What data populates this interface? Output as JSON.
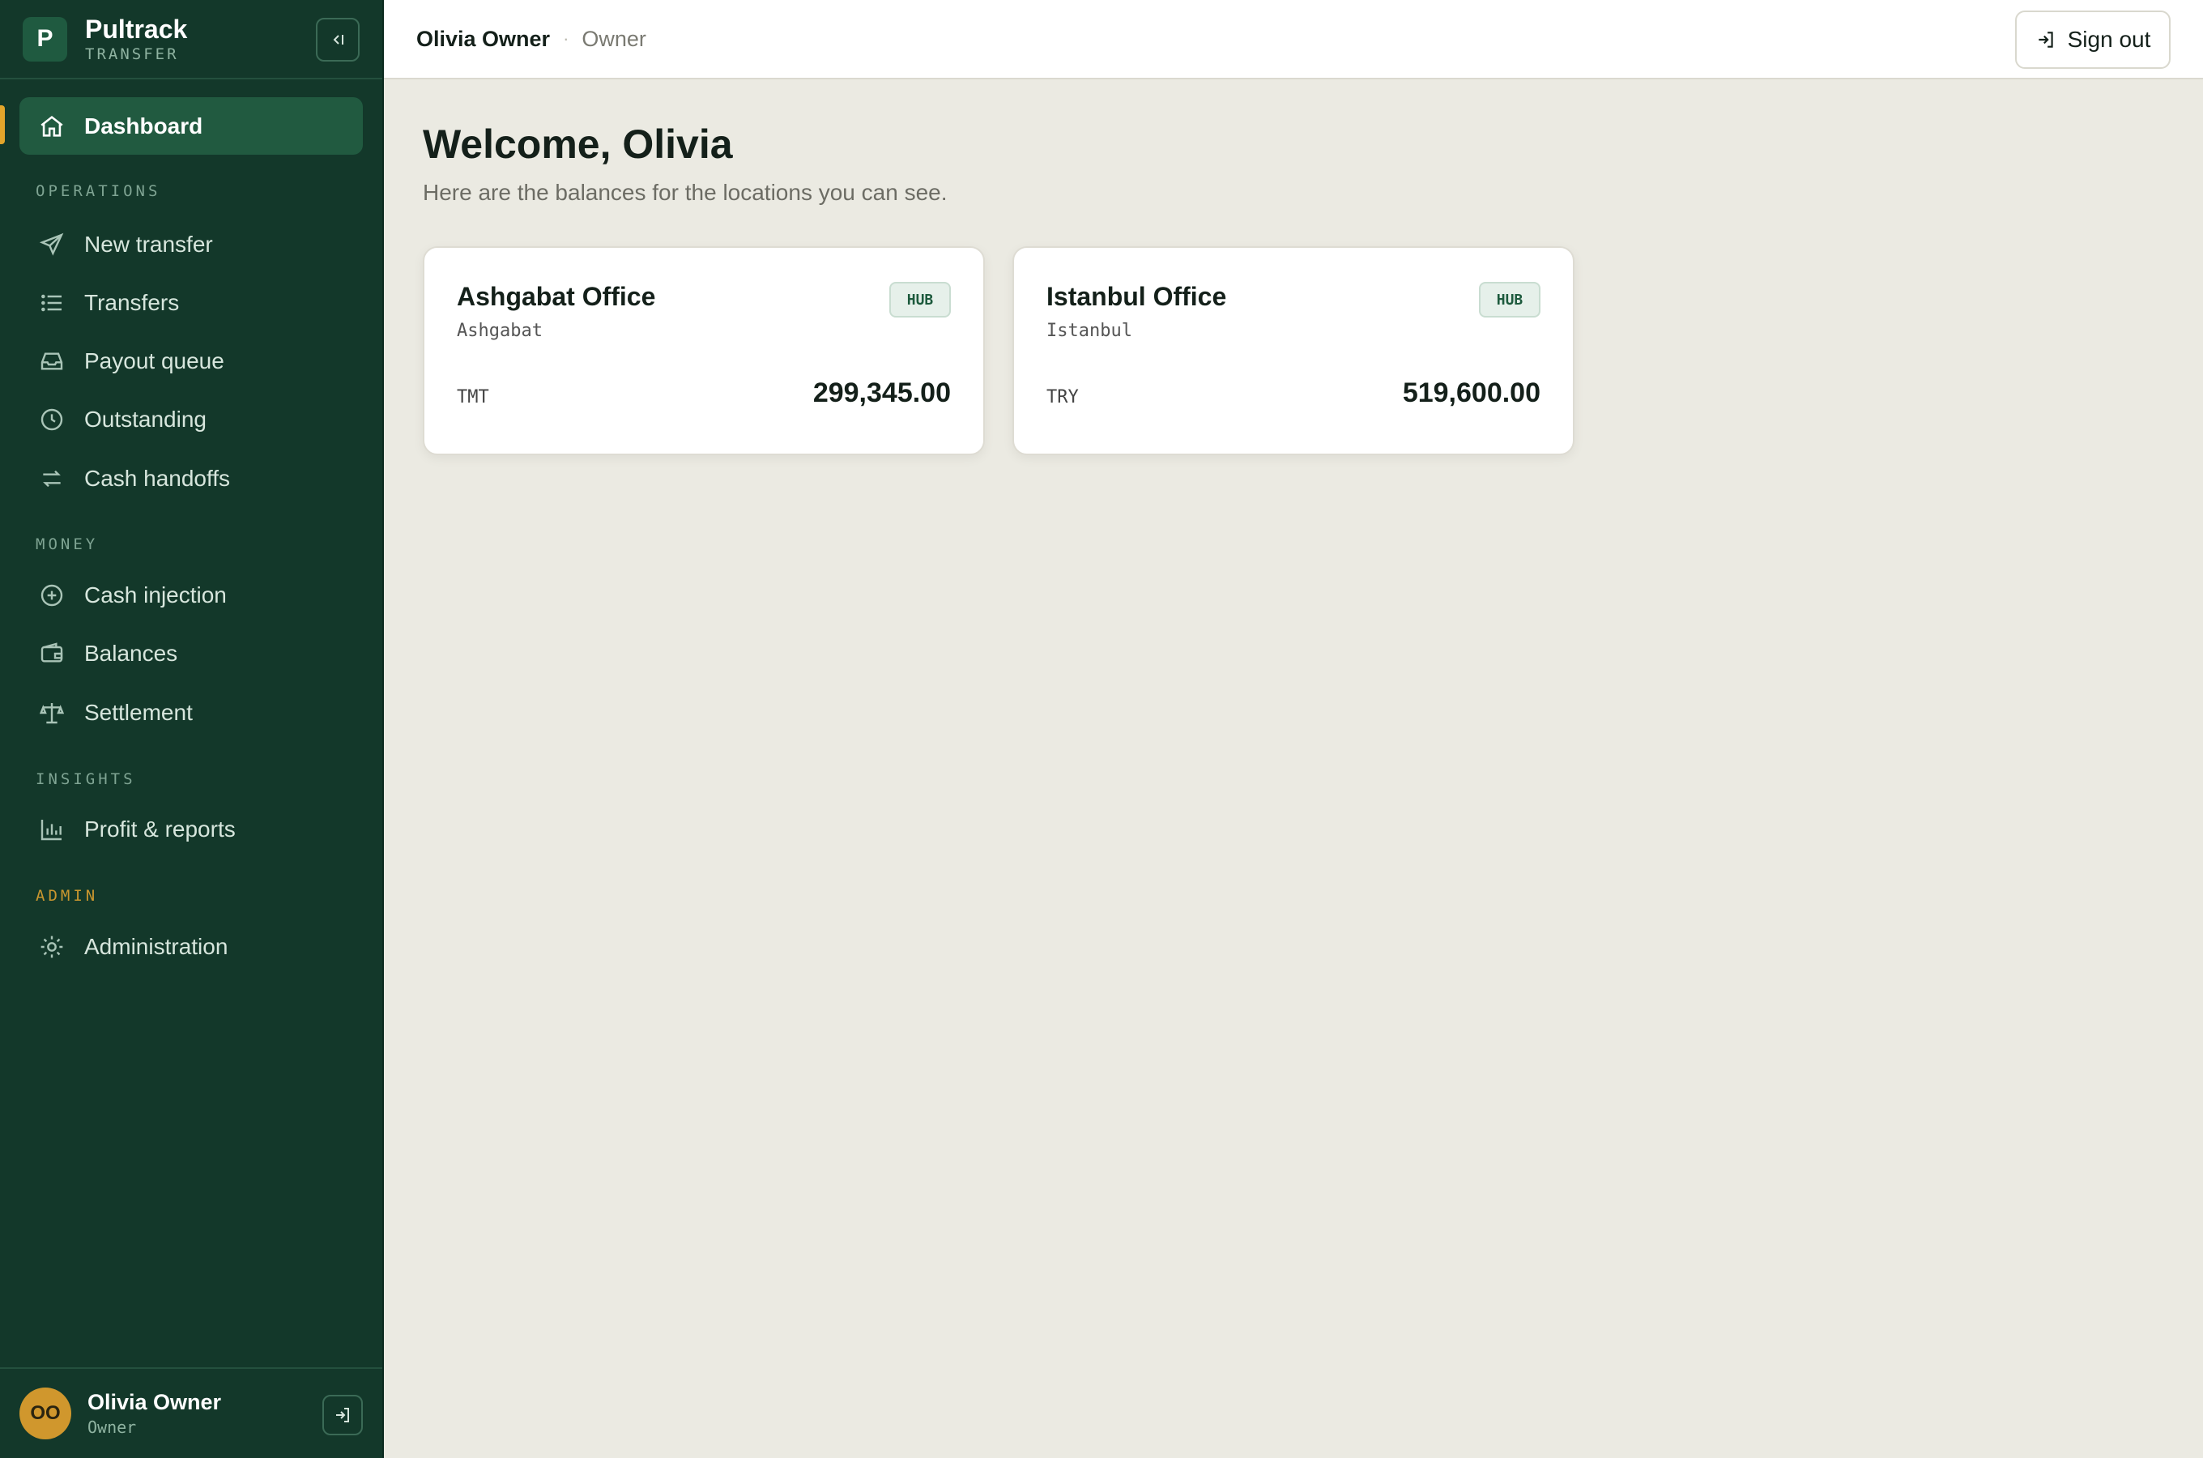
{
  "brand": {
    "name": "Pultrack",
    "sub": "TRANSFER",
    "logo_letter": "P"
  },
  "nav": {
    "dashboard": "Dashboard",
    "sections": {
      "operations": "OPERATIONS",
      "money": "MONEY",
      "insights": "INSIGHTS",
      "admin": "ADMIN"
    },
    "items": {
      "new_transfer": "New transfer",
      "transfers": "Transfers",
      "payout_queue": "Payout queue",
      "outstanding": "Outstanding",
      "cash_handoffs": "Cash handoffs",
      "cash_injection": "Cash injection",
      "balances": "Balances",
      "settlement": "Settlement",
      "profit_reports": "Profit & reports",
      "administration": "Administration"
    }
  },
  "user": {
    "initials": "OO",
    "name": "Olivia Owner",
    "role": "Owner"
  },
  "topbar": {
    "name": "Olivia Owner",
    "separator": "·",
    "role": "Owner",
    "signout": "Sign out"
  },
  "page": {
    "title": "Welcome, Olivia",
    "subtitle": "Here are the balances for the locations you can see."
  },
  "cards": [
    {
      "name": "Ashgabat Office",
      "city": "Ashgabat",
      "badge": "HUB",
      "currency": "TMT",
      "amount": "299,345.00"
    },
    {
      "name": "Istanbul Office",
      "city": "Istanbul",
      "badge": "HUB",
      "currency": "TRY",
      "amount": "519,600.00"
    }
  ],
  "colors": {
    "sidebar": "#13382a",
    "accent": "#e3a52b",
    "active": "#215a40",
    "background": "#ebeae2"
  }
}
